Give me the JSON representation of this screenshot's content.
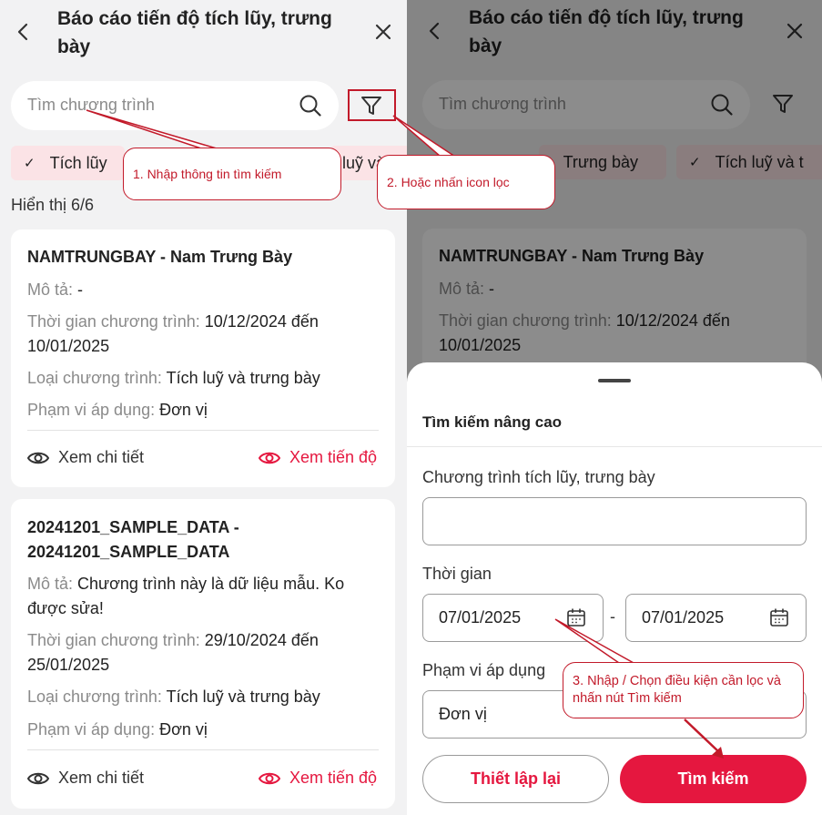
{
  "header": {
    "title": "Báo cáo tiến độ tích lũy, trưng bày"
  },
  "search": {
    "placeholder": "Tìm chương trình"
  },
  "chips_left": [
    {
      "label": "Tích lũy"
    },
    {
      "label": "luỹ và"
    }
  ],
  "chips_right": [
    {
      "label": "Trưng bày"
    },
    {
      "label": "Tích luỹ và t"
    }
  ],
  "count_text": "Hiển thị 6/6",
  "labels": {
    "description": "Mô tả:",
    "time": "Thời gian chương trình:",
    "type": "Loại chương trình:",
    "scope": "Phạm vi áp dụng:"
  },
  "cards": [
    {
      "title": "NAMTRUNGBAY - Nam Trưng Bày",
      "description": "-",
      "time": "10/12/2024 đến 10/01/2025",
      "type": "Tích luỹ và trưng bày",
      "scope": "Đơn vị"
    },
    {
      "title": "20241201_SAMPLE_DATA - 20241201_SAMPLE_DATA",
      "description": "Chương trình này là dữ liệu mẫu. Ko được sửa!",
      "time": "29/10/2024 đến 25/01/2025",
      "type": "Tích luỹ và trưng bày",
      "scope": "Đơn vị"
    }
  ],
  "actions": {
    "view_detail": "Xem chi tiết",
    "view_progress": "Xem tiến độ"
  },
  "sheet": {
    "title": "Tìm kiếm nâng cao",
    "program_label": "Chương trình tích lũy, trưng bày",
    "program_value": "",
    "time_label": "Thời gian",
    "date_from": "07/01/2025",
    "date_separator": "-",
    "date_to": "07/01/2025",
    "scope_label": "Phạm vi áp dụng",
    "scope_value": "Đơn vị",
    "reset_button": "Thiết lập lại",
    "search_button": "Tìm kiếm"
  },
  "annotations": {
    "step1": "1. Nhập thông tin tìm kiếm",
    "step2": "2. Hoặc nhấn icon lọc",
    "step3": "3. Nhập / Chọn điều kiện cần lọc và nhấn nút Tìm kiếm"
  },
  "colors": {
    "accent": "#e5173f",
    "chip_bg": "#fbe3e6",
    "annotation": "#c21a2a",
    "page_bg": "#f2f2f3"
  },
  "icons": [
    "back-icon",
    "close-icon",
    "search-icon",
    "filter-icon",
    "check-icon",
    "eye-icon",
    "calendar-icon"
  ]
}
